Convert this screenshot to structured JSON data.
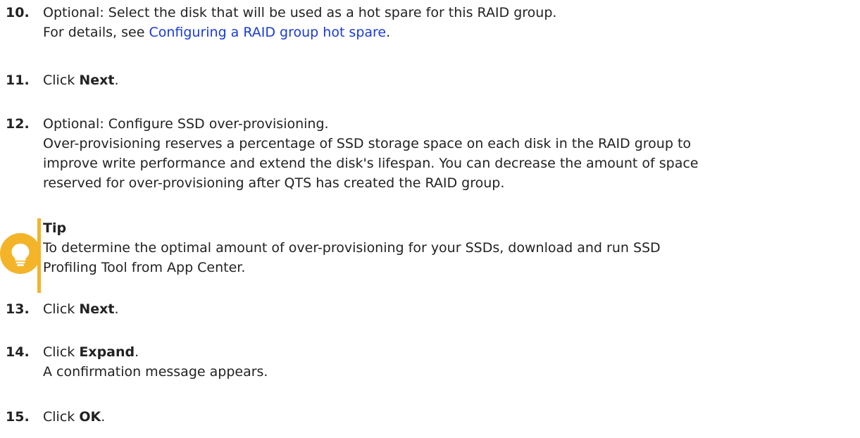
{
  "steps": [
    {
      "num": "10.",
      "lines": [
        "Optional: Select the disk that will be used as a hot spare for this RAID group."
      ],
      "detail_prefix": "For details, see ",
      "detail_link": "Configuring a RAID group hot spare",
      "detail_suffix": "."
    },
    {
      "num": "11.",
      "prefix": "Click ",
      "bold": "Next",
      "suffix": "."
    },
    {
      "num": "12.",
      "lines": [
        "Optional: Configure SSD over-provisioning.",
        "Over-provisioning reserves a percentage of SSD storage space on each disk in the RAID group to",
        "improve write performance and extend the disk's lifespan. You can decrease the amount of space",
        "reserved for over-provisioning after QTS has created the RAID group."
      ]
    },
    {
      "num": "13.",
      "prefix": "Click ",
      "bold": "Next",
      "suffix": "."
    },
    {
      "num": "14.",
      "prefix": "Click ",
      "bold": "Expand",
      "suffix": ".",
      "detail": "A confirmation message appears."
    },
    {
      "num": "15.",
      "prefix": "Click ",
      "bold": "OK",
      "suffix": "."
    }
  ],
  "tip": {
    "title": "Tip",
    "lines": [
      "To determine the optimal amount of over-provisioning for your SSDs, download and run SSD",
      "Profiling Tool from App Center."
    ],
    "icon": "lightbulb-icon",
    "accent_color": "#f3b42a"
  }
}
